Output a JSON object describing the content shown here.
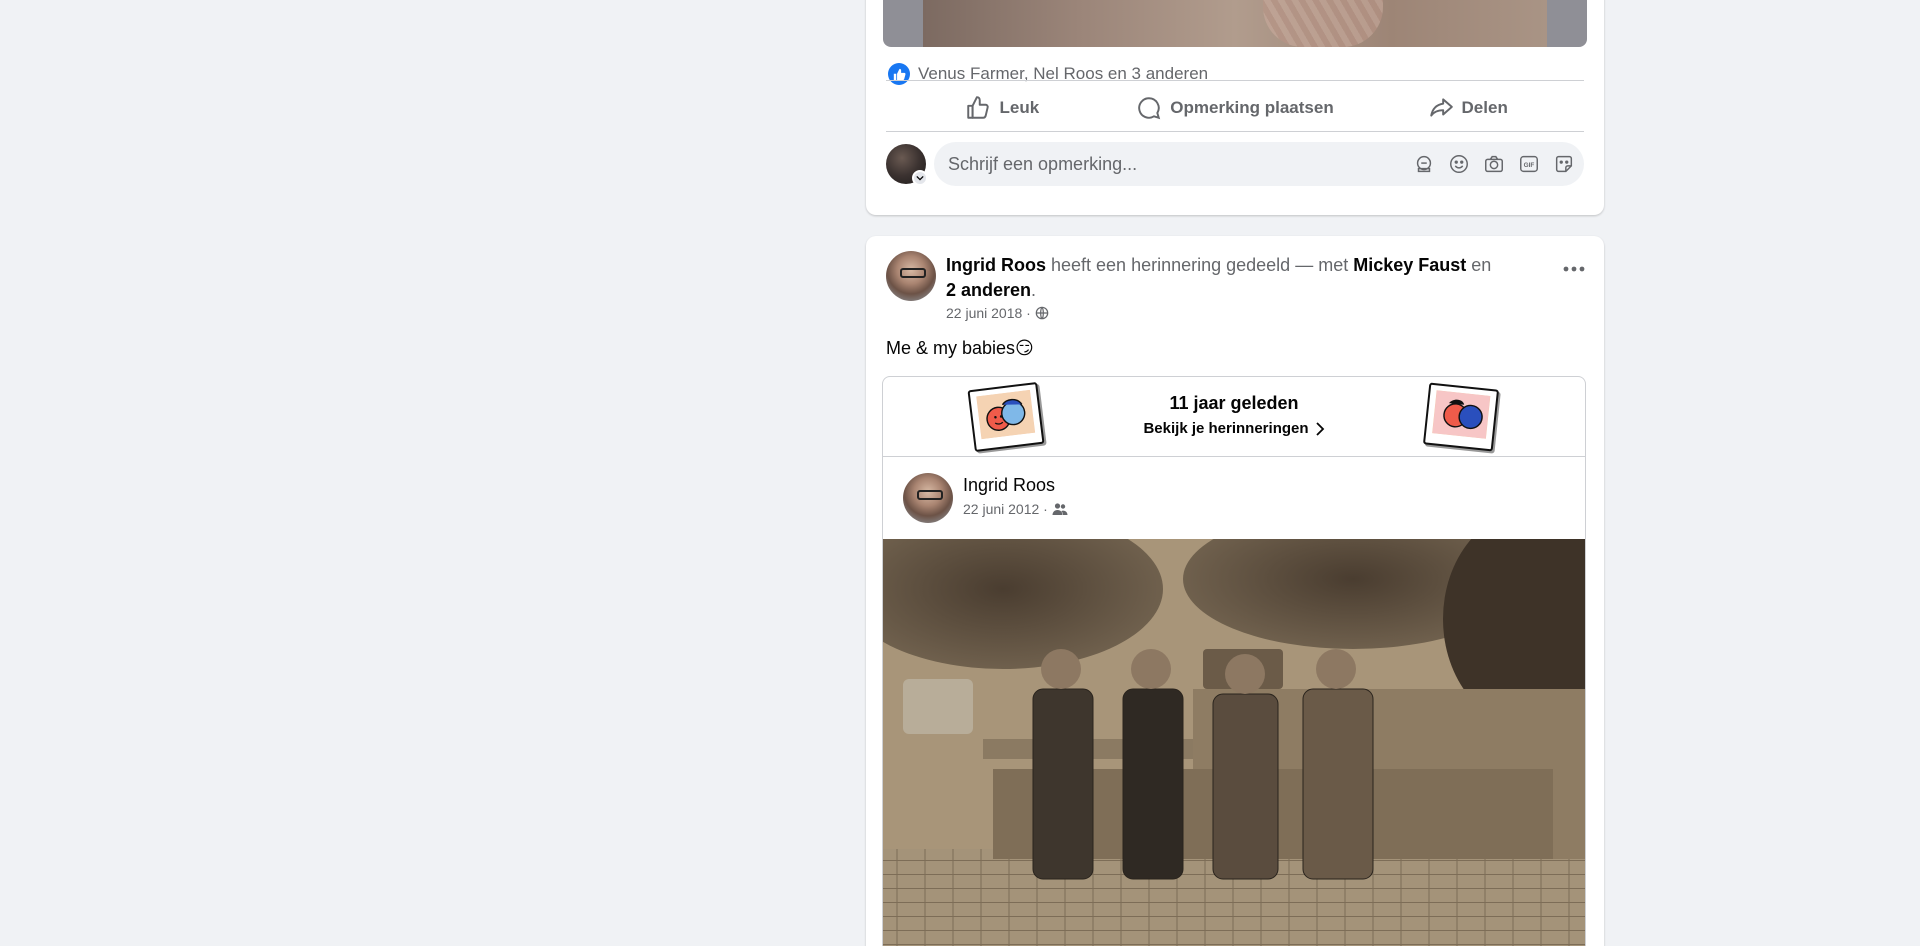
{
  "post1": {
    "reactions_text": "Venus Farmer, Nel Roos en 3 anderen",
    "actions": {
      "like": "Leuk",
      "comment": "Opmerking plaatsen",
      "share": "Delen"
    },
    "comment_placeholder": "Schrijf een opmerking..."
  },
  "post2": {
    "author": "Ingrid Roos",
    "action_text": " heeft een herinnering gedeeld — met ",
    "tagged": "Mickey Faust",
    "and_text": " en ",
    "others": "2 anderen",
    "period": ".",
    "date": "22 juni 2018 ·",
    "privacy_icon": "globe-icon",
    "text": "Me & my babies😏",
    "memory": {
      "title": "11 jaar geleden",
      "link": "Bekijk je herinneringen",
      "original_author": "Ingrid Roos",
      "original_date": "22 juni 2012 ·",
      "original_privacy_icon": "friends-icon"
    }
  },
  "colors": {
    "accent": "#1877f2",
    "muted": "#65676b",
    "background": "#f0f2f5"
  }
}
